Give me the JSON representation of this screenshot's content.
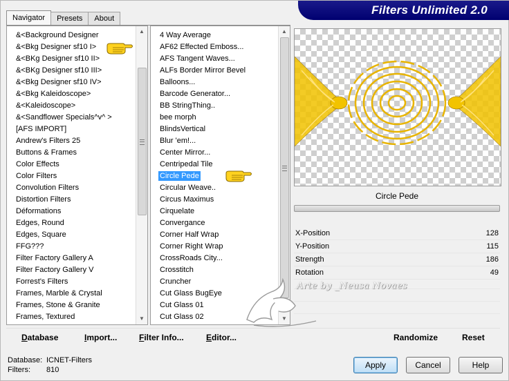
{
  "banner": {
    "title": "Filters Unlimited 2.0"
  },
  "tabs": [
    {
      "label": "Navigator",
      "active": true
    },
    {
      "label": "Presets",
      "active": false
    },
    {
      "label": "About",
      "active": false
    }
  ],
  "categories": [
    "&<Background Designer",
    "&<Bkg Designer sf10 I>",
    "&<BKg Designer sf10 II>",
    "&<BKg Designer sf10 III>",
    "&<Bkg Designer sf10 IV>",
    "&<Bkg Kaleidoscope>",
    "&<Kaleidoscope>",
    "&<Sandflower Specials^v^ >",
    "[AFS IMPORT]",
    "Andrew's Filters 25",
    "Buttons & Frames",
    "Color Effects",
    "Color Filters",
    "Convolution Filters",
    "Distortion Filters",
    "Déformations",
    "Edges, Round",
    "Edges, Square",
    "FFG???",
    "Filter Factory Gallery A",
    "Filter Factory Gallery V",
    "Forrest's Filters",
    "Frames, Marble & Crystal",
    "Frames, Stone & Granite",
    "Frames, Textured"
  ],
  "filters": [
    "4 Way Average",
    "AF62 Effected Emboss...",
    "AFS Tangent Waves...",
    "ALFs Border Mirror Bevel",
    "Balloons...",
    "Barcode Generator...",
    "BB StringThing..",
    "bee morph",
    "BlindsVertical",
    "Blur 'em!...",
    "Center Mirror...",
    "Centripedal Tile",
    "Circle Pede",
    "Circular Weave..",
    "Circus Maximus",
    "Cirquelate",
    "Convergance",
    "Corner Half Wrap",
    "Corner Right Wrap",
    "CrossRoads City...",
    "Crosstitch",
    "Cruncher",
    "Cut Glass  BugEye",
    "Cut Glass 01",
    "Cut Glass 02"
  ],
  "selected_filter_index": 12,
  "filter_name": "Circle Pede",
  "params": [
    {
      "label": "X-Position",
      "value": "128"
    },
    {
      "label": "Y-Position",
      "value": "115"
    },
    {
      "label": "Strength",
      "value": "186"
    },
    {
      "label": "Rotation",
      "value": "49"
    }
  ],
  "toolbar": {
    "database": "Database",
    "database_key": "D",
    "import": "Import...",
    "import_key": "I",
    "filter_info": "Filter Info...",
    "filter_info_key": "F",
    "editor": "Editor...",
    "editor_key": "E",
    "randomize": "Randomize",
    "reset": "Reset"
  },
  "status": {
    "database_label": "Database:",
    "database_value": "ICNET-Filters",
    "filters_label": "Filters:",
    "filters_value": "810"
  },
  "buttons": {
    "apply": "Apply",
    "cancel": "Cancel",
    "help": "Help"
  },
  "watermark": "Arte by _Neusa Novaes",
  "colors": {
    "banner": "#00007a",
    "selection": "#3399ff",
    "preview_effect": "#f0c000"
  }
}
